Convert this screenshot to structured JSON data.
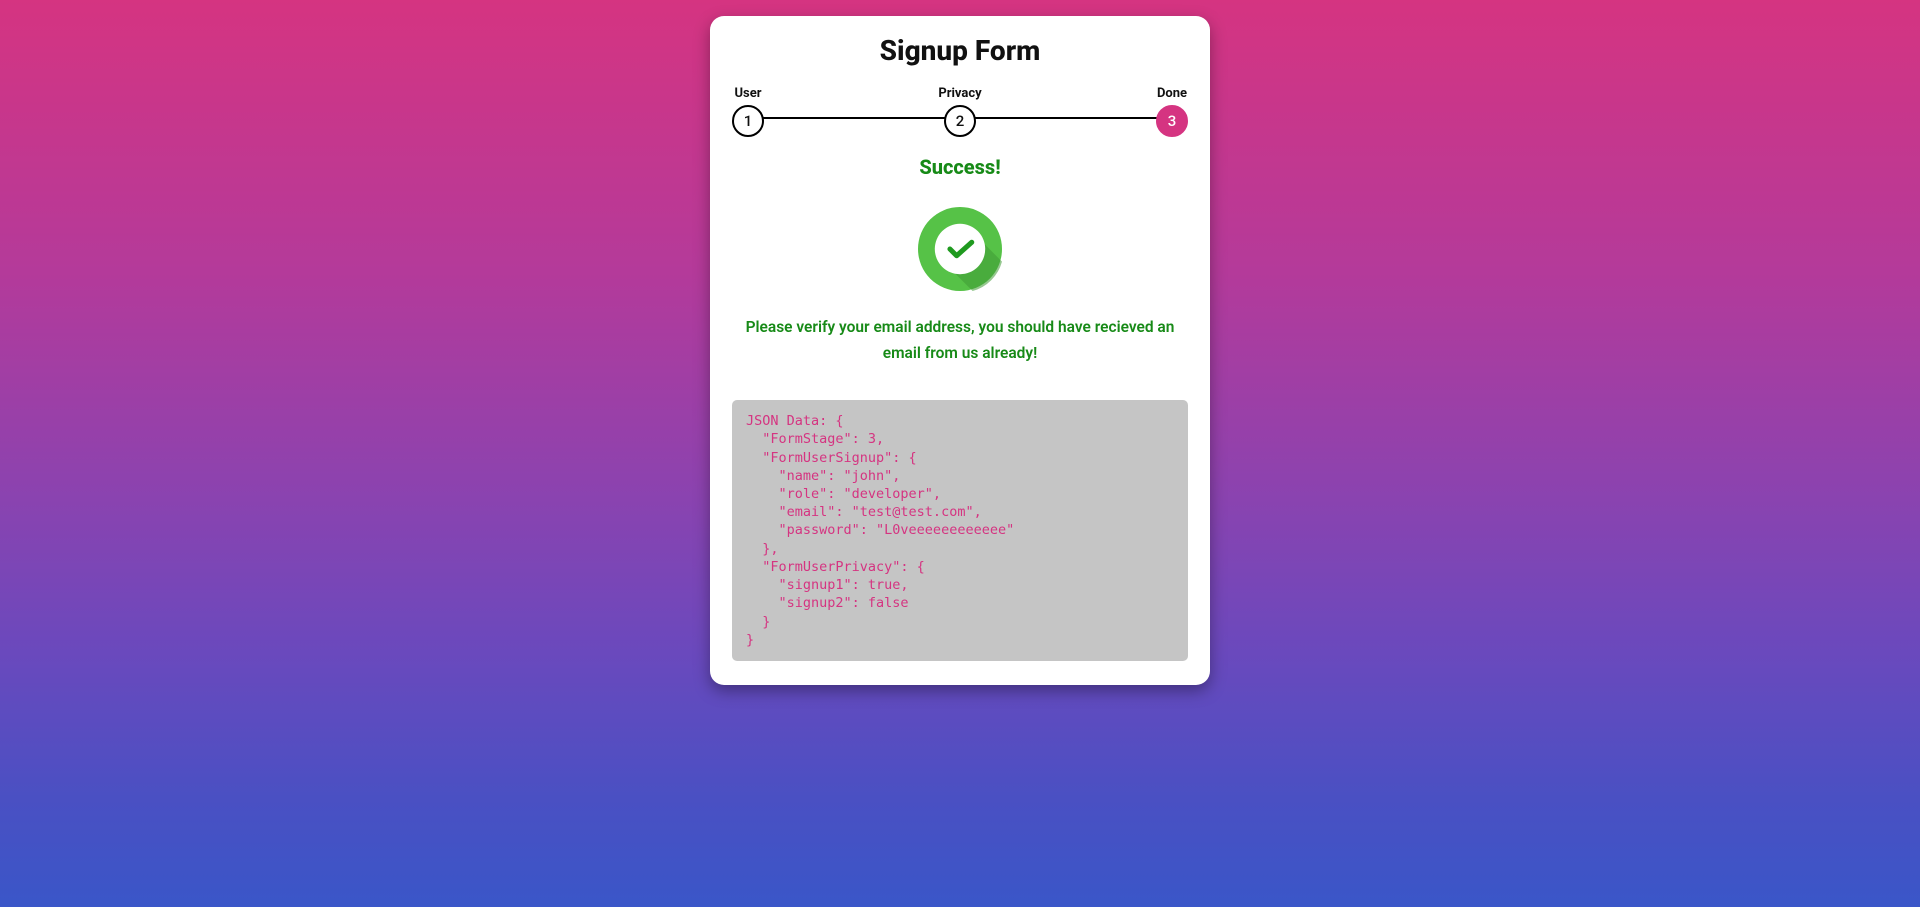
{
  "title": "Signup Form",
  "stepper": {
    "steps": [
      {
        "label": "User",
        "number": "1",
        "active": false
      },
      {
        "label": "Privacy",
        "number": "2",
        "active": false
      },
      {
        "label": "Done",
        "number": "3",
        "active": true
      }
    ]
  },
  "completed": {
    "heading": "Success!",
    "message": "Please verify your email address, you should have recieved an email from us already!"
  },
  "json_dump_label": "JSON Data:",
  "form_state": {
    "FormStage": 3,
    "FormUserSignup": {
      "name": "john",
      "role": "developer",
      "email": "test@test.com",
      "password": "L0veeeeeeeeeeee"
    },
    "FormUserPrivacy": {
      "signup1": true,
      "signup2": false
    }
  },
  "colors": {
    "accent": "#d53481",
    "success": "#178a17",
    "code_bg": "#c5c5c5"
  }
}
